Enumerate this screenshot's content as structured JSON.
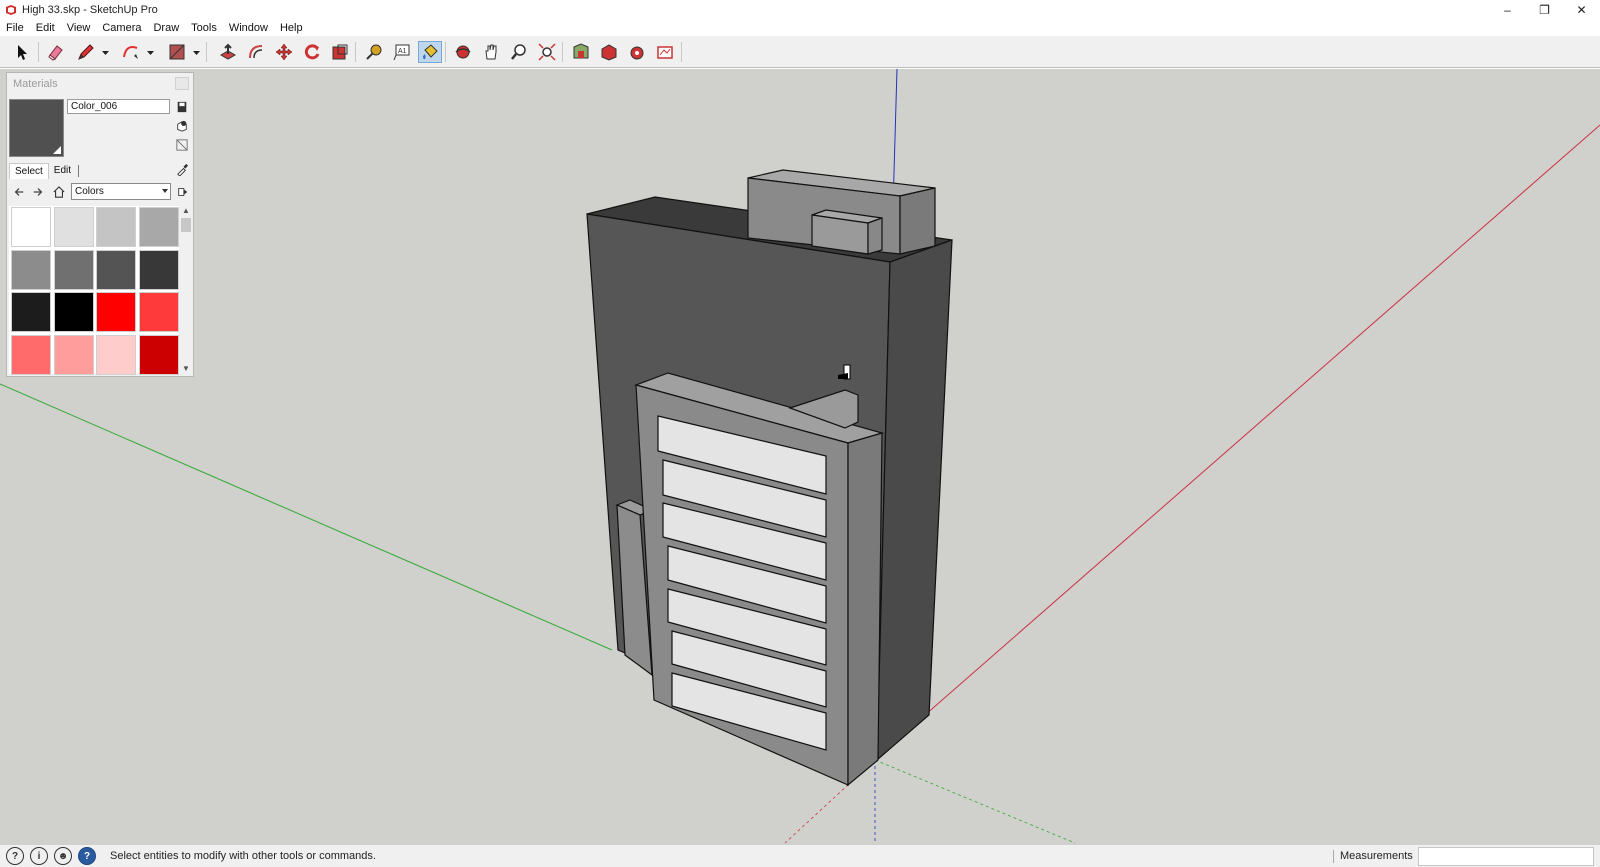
{
  "window": {
    "title": "High 33.skp - SketchUp Pro",
    "controls": [
      "minimize",
      "restore",
      "close"
    ]
  },
  "menu": [
    "File",
    "Edit",
    "View",
    "Camera",
    "Draw",
    "Tools",
    "Window",
    "Help"
  ],
  "toolbar": {
    "tools": [
      {
        "id": "select",
        "icon": "select-arrow-icon"
      },
      {
        "id": "eraser",
        "icon": "eraser-icon"
      },
      {
        "id": "line",
        "icon": "pencil-icon"
      },
      {
        "id": "arc",
        "icon": "arc-icon"
      },
      {
        "id": "rectangle",
        "icon": "rectangle-icon"
      },
      {
        "id": "push-pull",
        "icon": "push-pull-icon"
      },
      {
        "id": "offset",
        "icon": "offset-icon"
      },
      {
        "id": "move",
        "icon": "move-icon"
      },
      {
        "id": "rotate",
        "icon": "rotate-icon"
      },
      {
        "id": "scale",
        "icon": "scale-icon"
      },
      {
        "id": "tape-measure",
        "icon": "tape-measure-icon"
      },
      {
        "id": "text",
        "icon": "text-icon"
      },
      {
        "id": "paint-bucket",
        "icon": "paint-bucket-icon",
        "active": true
      },
      {
        "id": "orbit",
        "icon": "orbit-icon"
      },
      {
        "id": "pan",
        "icon": "pan-icon"
      },
      {
        "id": "zoom",
        "icon": "zoom-icon"
      },
      {
        "id": "zoom-extents",
        "icon": "zoom-extents-icon"
      },
      {
        "id": "3d-warehouse",
        "icon": "warehouse-icon"
      },
      {
        "id": "extension-warehouse",
        "icon": "extension-warehouse-icon"
      },
      {
        "id": "extension-manager",
        "icon": "extension-manager-icon"
      },
      {
        "id": "layout",
        "icon": "layout-icon"
      }
    ]
  },
  "materials": {
    "panel_title": "Materials",
    "current_name": "Color_006",
    "current_color": "#505050",
    "tabs": [
      "Select",
      "Edit"
    ],
    "active_tab": "Select",
    "library": "Colors",
    "swatches": [
      "#ffffff",
      "#e0e0e0",
      "#c4c4c4",
      "#a8a8a8",
      "#8c8c8c",
      "#707070",
      "#545454",
      "#383838",
      "#1c1c1c",
      "#000000",
      "#ff0000",
      "#ff3a3a",
      "#ff6a6a",
      "#ff9c9c",
      "#ffcccc",
      "#cc0000"
    ]
  },
  "status": {
    "message": "Select entities to modify with other tools or commands.",
    "measurements_label": "Measurements",
    "measurements_value": ""
  },
  "colors": {
    "viewport_bg": "#d0d0cc",
    "axis_red": "#cc3344",
    "axis_green": "#33aa33",
    "axis_blue": "#2233bb"
  }
}
